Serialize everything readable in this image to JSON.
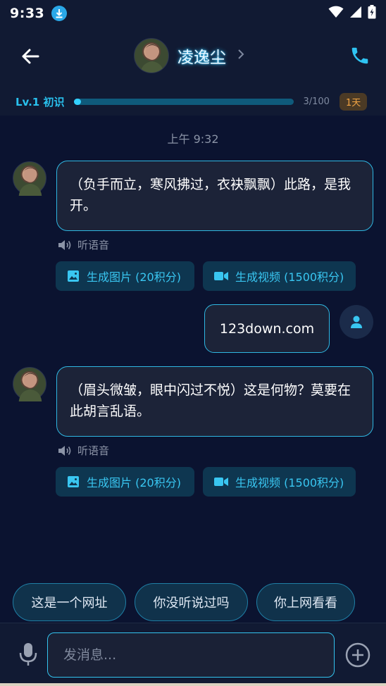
{
  "status_bar": {
    "time": "9:33"
  },
  "header": {
    "name": "凌逸尘"
  },
  "level": {
    "label": "Lv.1 初识",
    "progress": 0.03,
    "count": "3/100",
    "days": "1天"
  },
  "chat": {
    "timestamp": "上午 9:32",
    "messages": [
      {
        "sender": "ai",
        "text": "（负手而立，寒风拂过，衣袂飘飘）此路，是我开。"
      },
      {
        "sender": "user",
        "text": "123down.com"
      },
      {
        "sender": "ai",
        "text": "（眉头微皱，眼中闪过不悦）这是何物？莫要在此胡言乱语。"
      }
    ],
    "listen_label": "听语音",
    "gen_image_label": "生成图片 (20积分)",
    "gen_video_label": "生成视频 (1500积分)"
  },
  "suggestions": [
    "这是一个网址",
    "你没听说过吗",
    "你上网看看"
  ],
  "input": {
    "placeholder": "发消息...",
    "value": ""
  },
  "colors": {
    "accent": "#33c3ee",
    "background": "#0b1330",
    "bubble": "#1c2338",
    "badge": "#f2a544"
  }
}
